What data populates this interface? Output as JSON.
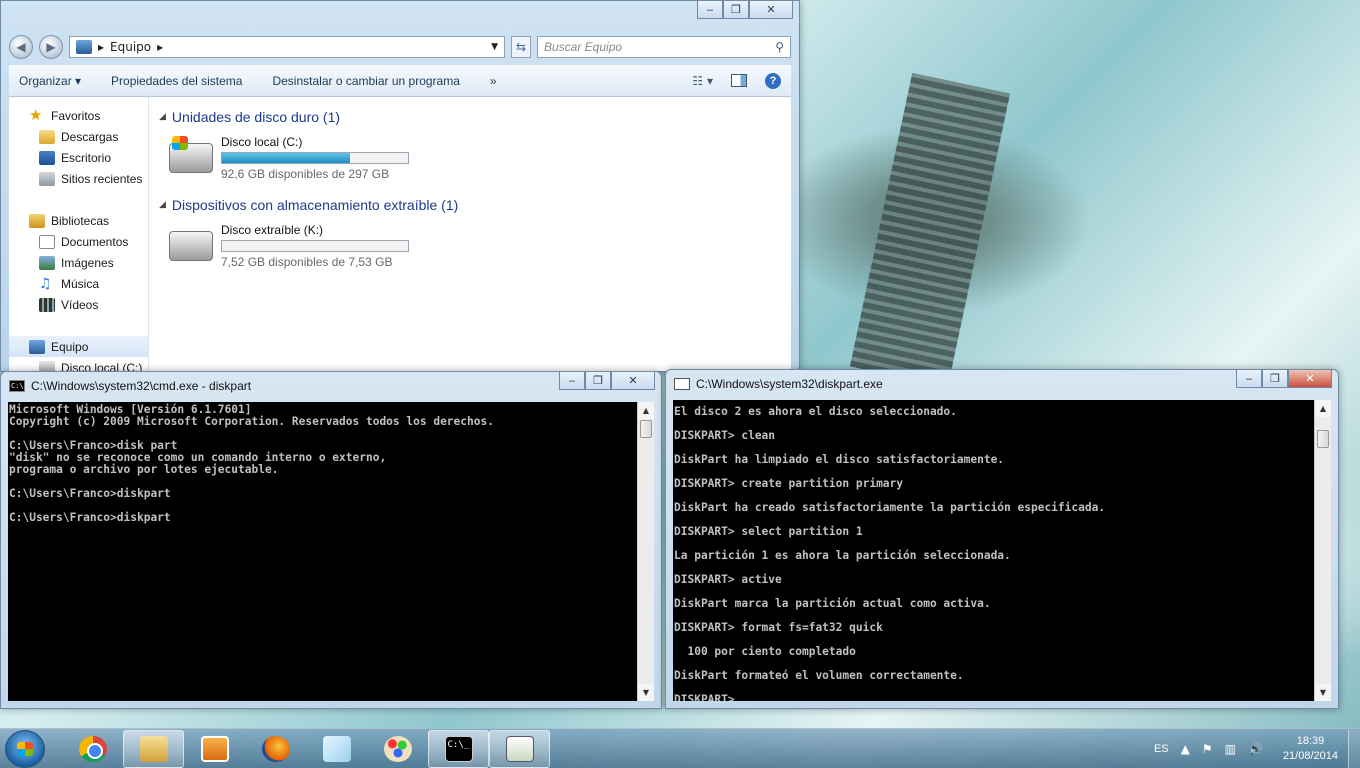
{
  "explorer": {
    "address": {
      "location": "Equipo"
    },
    "search": {
      "placeholder": "Buscar Equipo"
    },
    "toolbar": {
      "organize": "Organizar ▾",
      "system_props": "Propiedades del sistema",
      "uninstall": "Desinstalar o cambiar un programa",
      "more": "»"
    },
    "sidebar": {
      "favorites": "Favoritos",
      "downloads": "Descargas",
      "desktop": "Escritorio",
      "recent": "Sitios recientes",
      "libraries": "Bibliotecas",
      "documents": "Documentos",
      "images": "Imágenes",
      "music": "Música",
      "videos": "Vídeos",
      "computer": "Equipo",
      "local_disk": "Disco local (C:)"
    },
    "sections": {
      "hard_drives": "Unidades de disco duro (1)",
      "removable": "Dispositivos con almacenamiento extraíble (1)"
    },
    "drives": {
      "c": {
        "name": "Disco local (C:)",
        "free": "92,6 GB disponibles de 297 GB",
        "used_fraction": 0.69
      },
      "k": {
        "name": "Disco extraíble (K:)",
        "free": "7,52 GB disponibles de 7,53 GB",
        "used_fraction": 0.0
      }
    }
  },
  "cmd": {
    "title": "C:\\Windows\\system32\\cmd.exe - diskpart",
    "output": "Microsoft Windows [Versión 6.1.7601]\nCopyright (c) 2009 Microsoft Corporation. Reservados todos los derechos.\n\nC:\\Users\\Franco>disk part\n\"disk\" no se reconoce como un comando interno o externo,\nprograma o archivo por lotes ejecutable.\n\nC:\\Users\\Franco>diskpart\n\nC:\\Users\\Franco>diskpart"
  },
  "diskpart": {
    "title": "C:\\Windows\\system32\\diskpart.exe",
    "output": "El disco 2 es ahora el disco seleccionado.\nDISKPART> clean\nDiskPart ha limpiado el disco satisfactoriamente.\nDISKPART> create partition primary\nDiskPart ha creado satisfactoriamente la partición especificada.\nDISKPART> select partition 1\nLa partición 1 es ahora la partición seleccionada.\nDISKPART> active\nDiskPart marca la partición actual como activa.\nDISKPART> format fs=fat32 quick\n  100 por ciento completado\nDiskPart formateó el volumen correctamente.\nDISKPART>"
  },
  "taskbar": {
    "language": "ES",
    "time": "18:39",
    "date": "21/08/2014"
  }
}
